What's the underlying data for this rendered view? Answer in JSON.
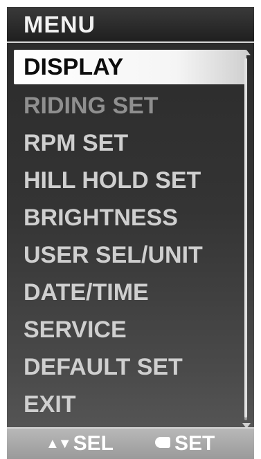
{
  "header": {
    "title": "MENU"
  },
  "menu": {
    "items": [
      {
        "label": "DISPLAY",
        "state": "selected"
      },
      {
        "label": "RIDING SET",
        "state": "dimmed"
      },
      {
        "label": "RPM SET",
        "state": "normal"
      },
      {
        "label": "HILL HOLD SET",
        "state": "normal"
      },
      {
        "label": "BRIGHTNESS",
        "state": "normal"
      },
      {
        "label": "USER SEL/UNIT",
        "state": "normal"
      },
      {
        "label": "DATE/TIME",
        "state": "normal"
      },
      {
        "label": "SERVICE",
        "state": "normal"
      },
      {
        "label": "DEFAULT SET",
        "state": "normal"
      },
      {
        "label": "EXIT",
        "state": "normal"
      }
    ]
  },
  "footer": {
    "sel_label": "SEL",
    "set_label": "SET",
    "sel_icon": "up-down-arrows-icon",
    "set_icon": "button-icon"
  },
  "colors": {
    "panel_background": "#2e2e2e",
    "selected_background": "#f5f5f5",
    "selected_text": "#0d0d0d",
    "item_text": "#cfcfcf",
    "dimmed_text": "#8f8f8f",
    "footer_background": "#a8a8a8"
  }
}
